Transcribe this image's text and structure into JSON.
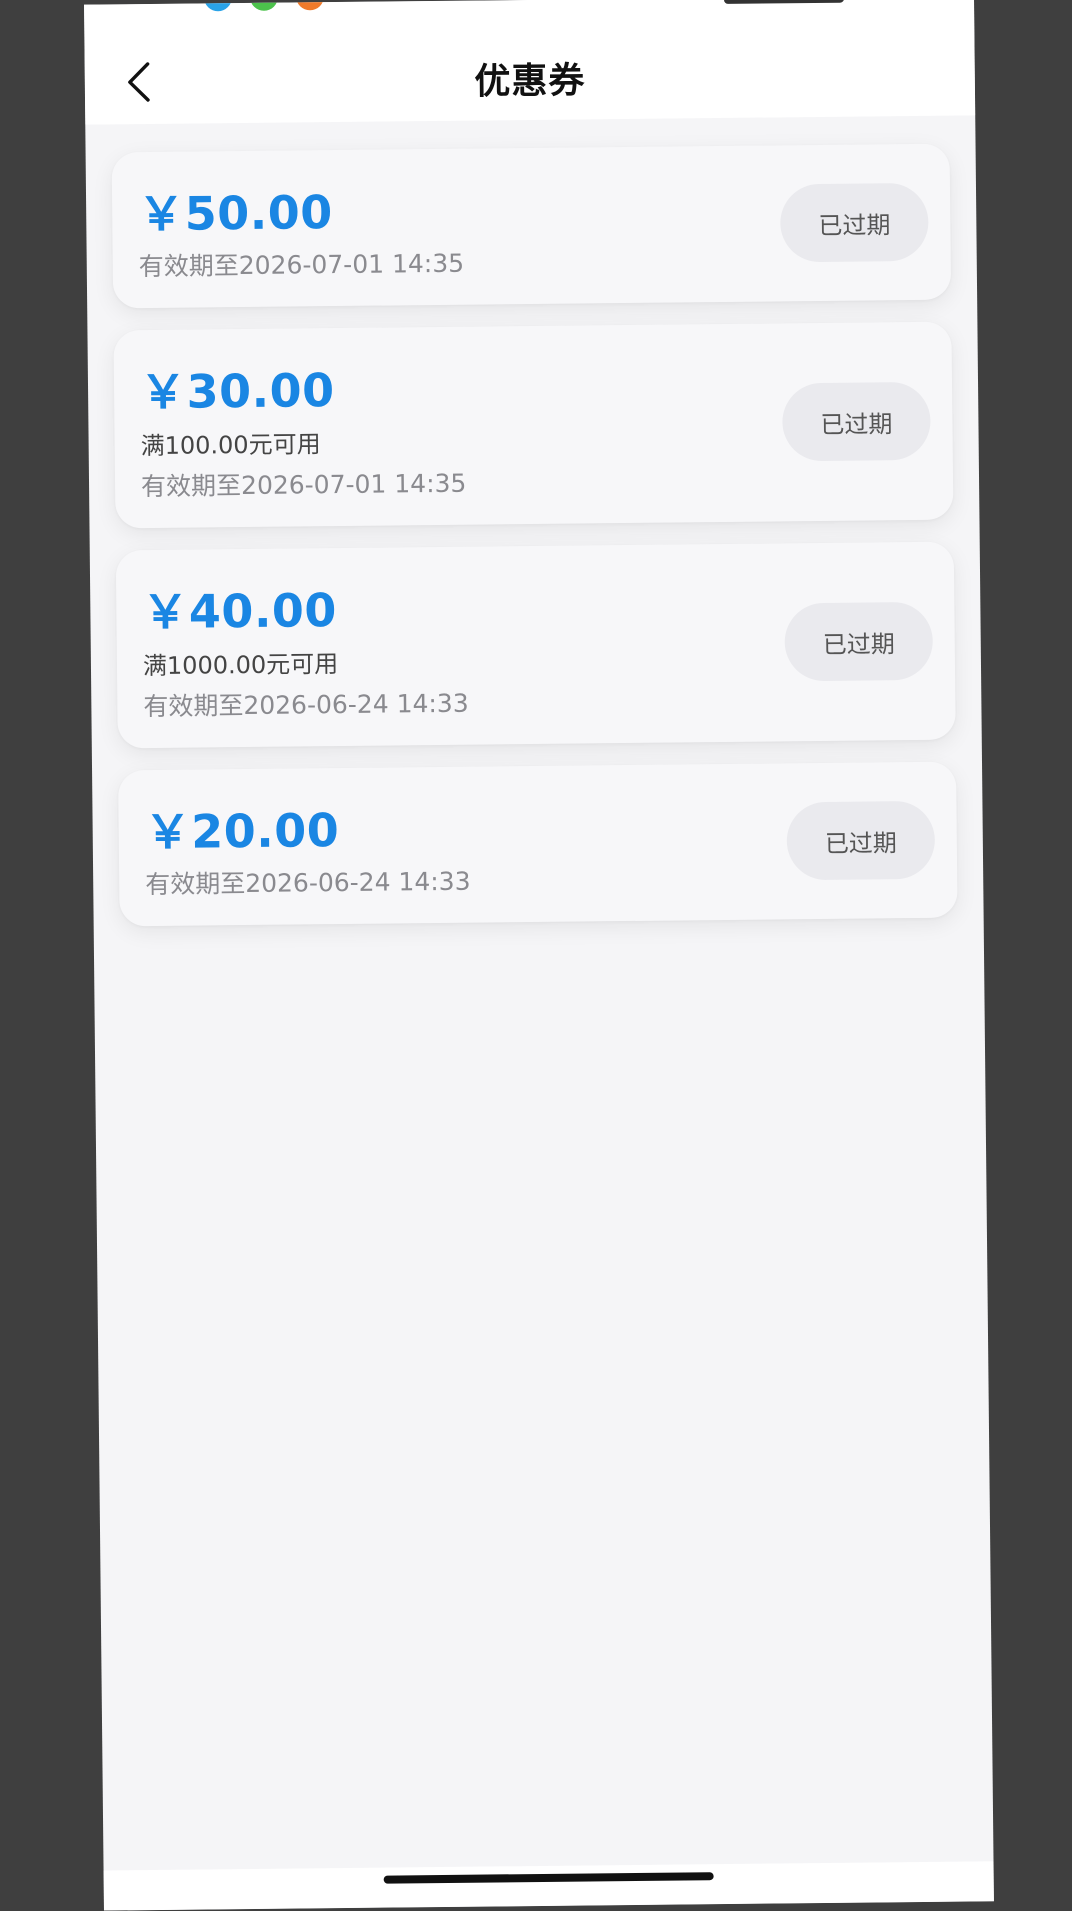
{
  "header": {
    "title": "优惠券",
    "back_icon": "chevron-left-icon"
  },
  "colors": {
    "accent": "#1a86e3",
    "status_pill_bg": "#eaeaee",
    "page_bg": "#f5f5f7"
  },
  "coupons": [
    {
      "amount": "￥50.00",
      "condition": "",
      "expiry": "有效期至2026-07-01 14:35",
      "status": "已过期"
    },
    {
      "amount": "￥30.00",
      "condition": "满100.00元可用",
      "expiry": "有效期至2026-07-01 14:35",
      "status": "已过期"
    },
    {
      "amount": "￥40.00",
      "condition": "满1000.00元可用",
      "expiry": "有效期至2026-06-24 14:33",
      "status": "已过期"
    },
    {
      "amount": "￥20.00",
      "condition": "",
      "expiry": "有效期至2026-06-24 14:33",
      "status": "已过期"
    }
  ]
}
